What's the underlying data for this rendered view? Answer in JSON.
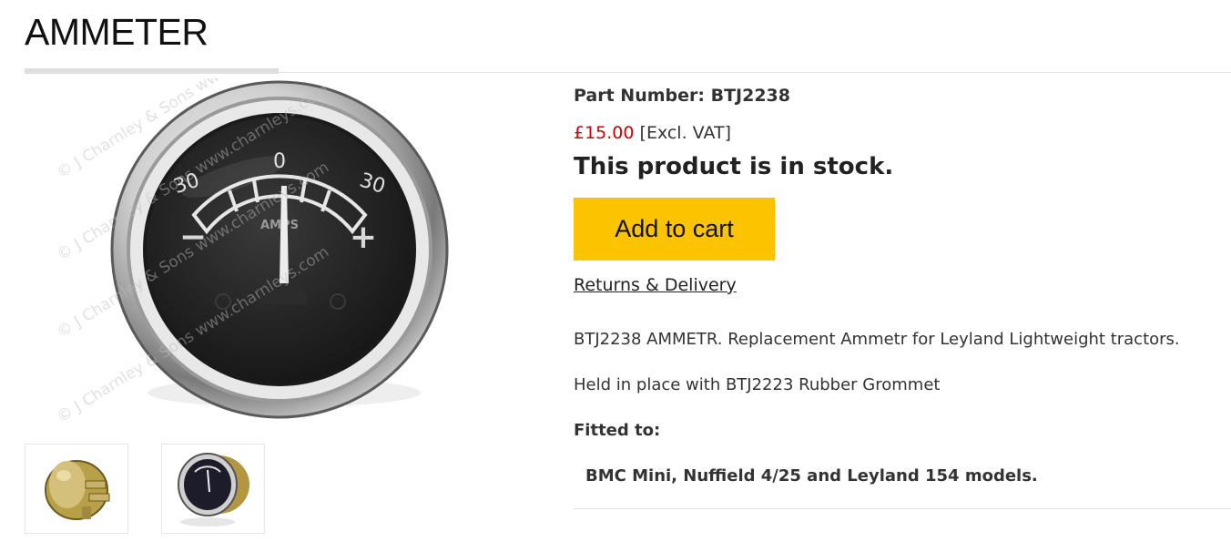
{
  "page": {
    "title": "AMMETER"
  },
  "gallery": {
    "main_image": {
      "icon": "ammeter-gauge-photo",
      "dial_label": "AMPS",
      "scale_left": "30",
      "scale_center": "0",
      "scale_right": "30",
      "minus_sign": "−",
      "plus_sign": "+",
      "watermark": "© J Charnley & Sons www.charnleys.com"
    },
    "thumbnails": [
      {
        "icon": "ammeter-rear-view-photo"
      },
      {
        "icon": "ammeter-front-angle-photo"
      }
    ]
  },
  "product": {
    "part_number": "Part Number: BTJ2238",
    "price": "£15.00",
    "vat_note": "[Excl. VAT]",
    "stock_status": "This product is in stock.",
    "add_to_cart": "Add to cart",
    "returns_link": "Returns & Delivery",
    "description": "BTJ2238 AMMETR.  Replacement Ammetr for Leyland Lightweight tractors.",
    "mounting_note": "Held in place with BTJ2223 Rubber Grommet",
    "fitted_label": "Fitted to:",
    "fitted_models": "BMC Mini, Nuffield 4/25 and Leyland 154 models."
  },
  "colors": {
    "price": "#d20000",
    "cart_button": "#fcc400",
    "accent_rule": "#dedede"
  }
}
